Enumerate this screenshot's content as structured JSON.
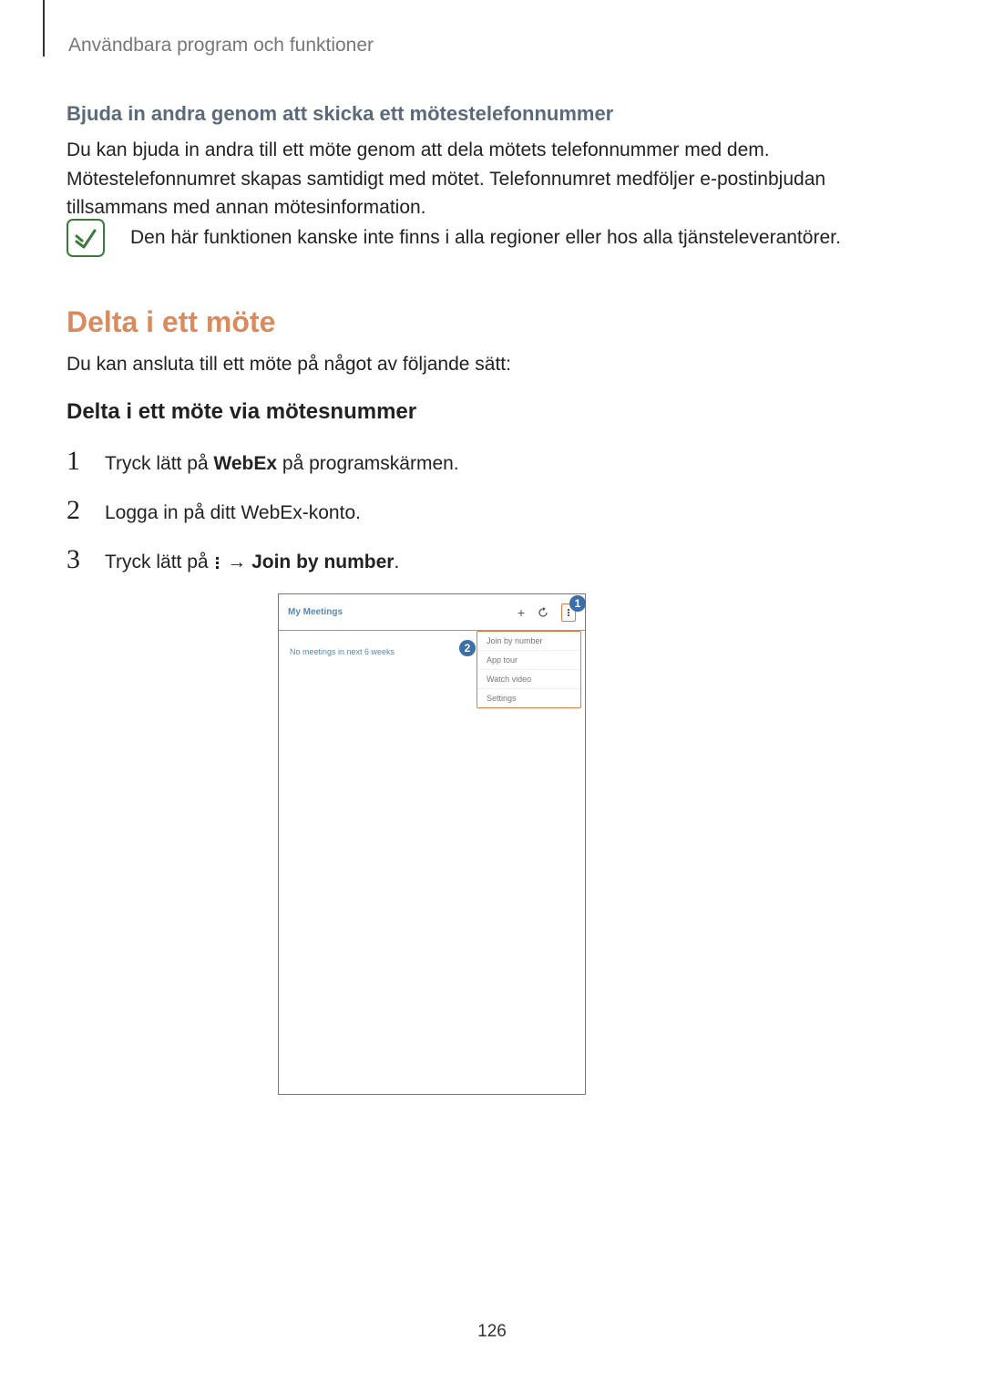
{
  "header": "Användbara program och funktioner",
  "section1": {
    "title": "Bjuda in andra genom att skicka ett mötestelefonnummer",
    "body": "Du kan bjuda in andra till ett möte genom att dela mötets telefonnummer med dem. Mötestelefonnumret skapas samtidigt med mötet. Telefonnumret medföljer e-postinbjudan tillsammans med annan mötesinformation.",
    "note": "Den här funktionen kanske inte finns i alla regioner eller hos alla tjänsteleverantörer."
  },
  "section2": {
    "title": "Delta i ett möte",
    "intro": "Du kan ansluta till ett möte på något av följande sätt:",
    "subtitle": "Delta i ett möte via mötesnummer",
    "steps": {
      "s1_pre": "Tryck lätt på ",
      "s1_bold": "WebEx",
      "s1_post": " på programskärmen.",
      "s2": "Logga in på ditt WebEx-konto.",
      "s3_pre": "Tryck lätt på ",
      "s3_arrow": " → ",
      "s3_bold": "Join by number",
      "s3_post": "."
    }
  },
  "mock": {
    "title": "My Meetings",
    "empty": "No meetings in next 6 weeks",
    "menu": [
      "Join by number",
      "App tour",
      "Watch video",
      "Settings"
    ],
    "callout1": "1",
    "callout2": "2"
  },
  "pagenum": "126"
}
